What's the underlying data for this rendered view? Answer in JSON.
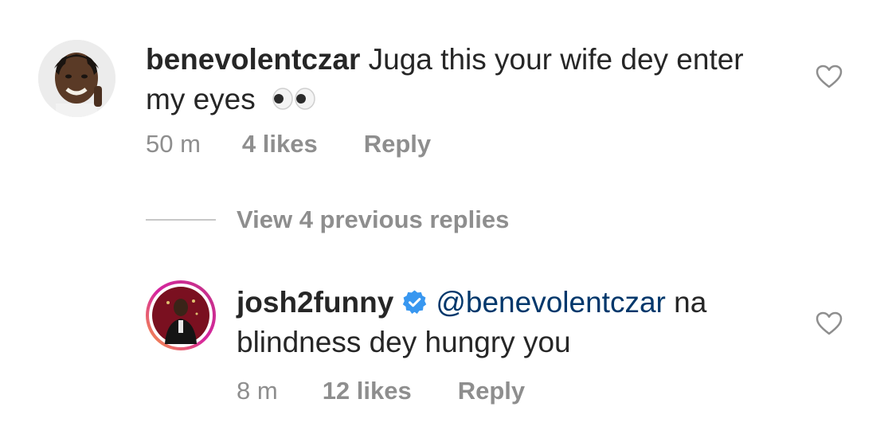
{
  "comment": {
    "username": "benevolentczar",
    "text": "Juga this your wife dey enter my eyes",
    "emoji_icon": "eyes-emoji-icon",
    "time": "50 m",
    "likes": "4 likes",
    "reply_label": "Reply"
  },
  "view_replies": {
    "label": "View 4 previous replies"
  },
  "reply": {
    "username": "josh2funny",
    "verified_icon": "verified-badge-icon",
    "mention": "@benevolentczar",
    "text_line1": "na",
    "text_line2": "blindness dey hungry you",
    "time": "8 m",
    "likes": "12 likes",
    "reply_label": "Reply"
  },
  "colors": {
    "text": "#262626",
    "muted": "#8e8e8e",
    "mention": "#00376b",
    "verified": "#3897f0",
    "story_ring": "#c13584"
  }
}
